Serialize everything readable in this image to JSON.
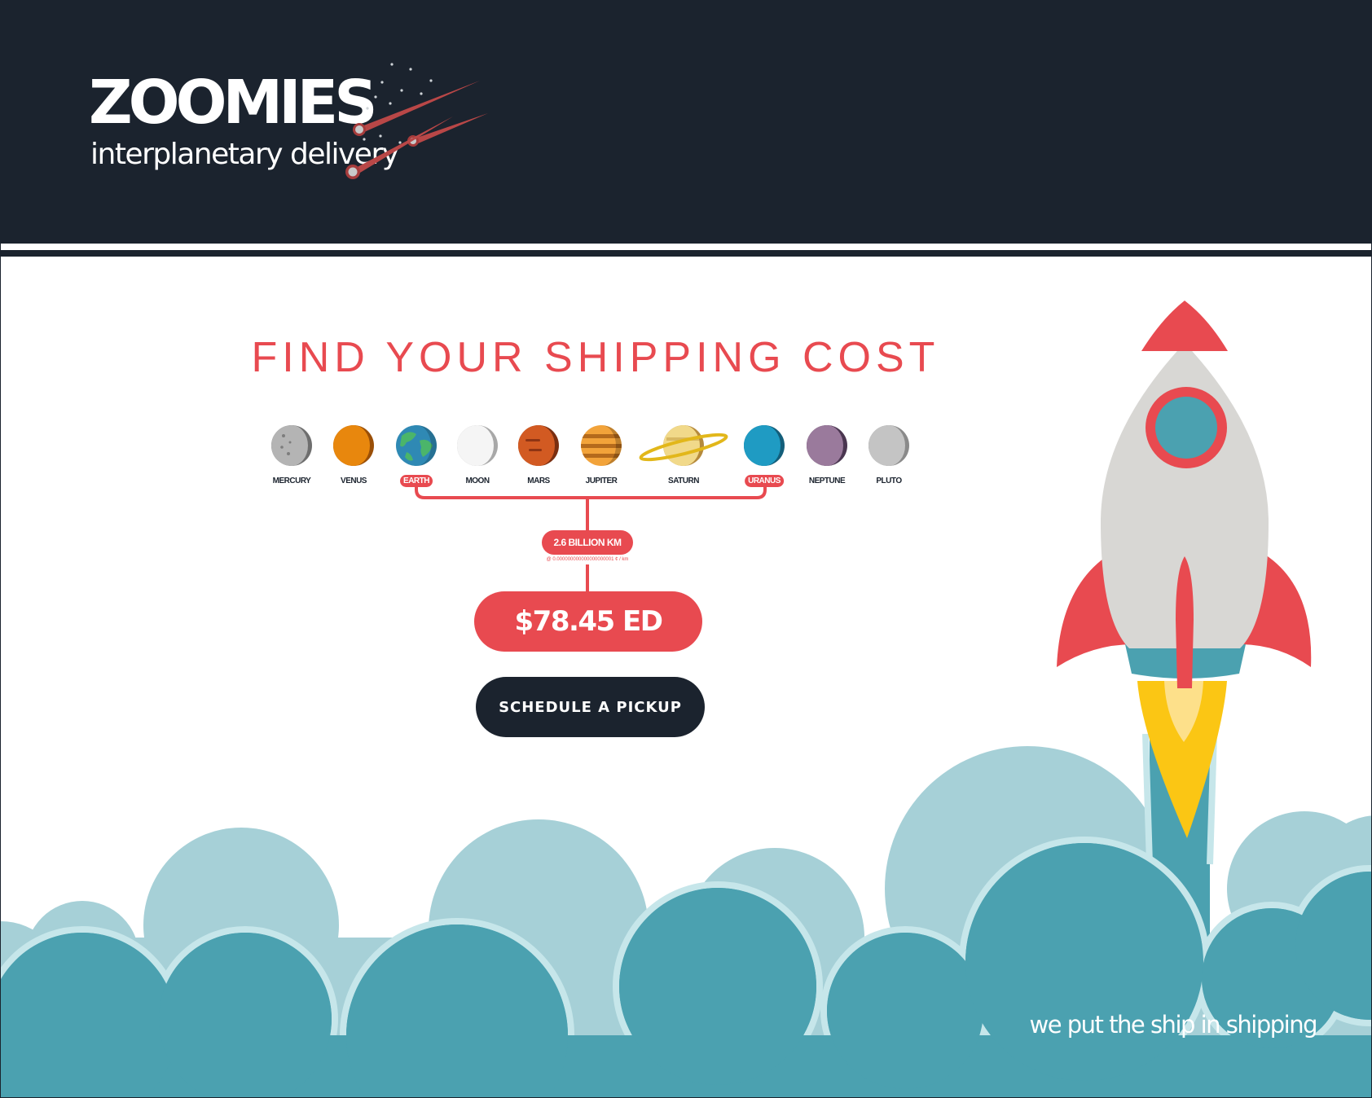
{
  "header": {
    "brand": "ZOOMIES",
    "tagline": "interplanetary delivery"
  },
  "calculator": {
    "title": "FIND YOUR SHIPPING COST",
    "planets": [
      {
        "label": "MERCURY",
        "icon": "mercury-icon",
        "selected": false
      },
      {
        "label": "VENUS",
        "icon": "venus-icon",
        "selected": false
      },
      {
        "label": "EARTH",
        "icon": "earth-icon",
        "selected": true
      },
      {
        "label": "MOON",
        "icon": "moon-icon",
        "selected": false
      },
      {
        "label": "MARS",
        "icon": "mars-icon",
        "selected": false
      },
      {
        "label": "JUPITER",
        "icon": "jupiter-icon",
        "selected": false
      },
      {
        "label": "SATURN",
        "icon": "saturn-icon",
        "selected": false
      },
      {
        "label": "URANUS",
        "icon": "uranus-icon",
        "selected": true
      },
      {
        "label": "NEPTUNE",
        "icon": "neptune-icon",
        "selected": false
      },
      {
        "label": "PLUTO",
        "icon": "pluto-icon",
        "selected": false
      }
    ],
    "distance": "2.6 BILLION KM",
    "rate": "@ 0.000000000000000000001 ¢ / km",
    "price": "$78.45 ED",
    "pickup_button": "SCHEDULE A PICKUP"
  },
  "footer": {
    "slogan": "we put the ship in shipping"
  },
  "colors": {
    "navy": "#1b232e",
    "accent_red": "#e84a50",
    "cloud_light": "#a6d0d7",
    "cloud_dark": "#4ba1b0",
    "rocket_body": "#d8d7d4",
    "flame": "#fbc614"
  }
}
